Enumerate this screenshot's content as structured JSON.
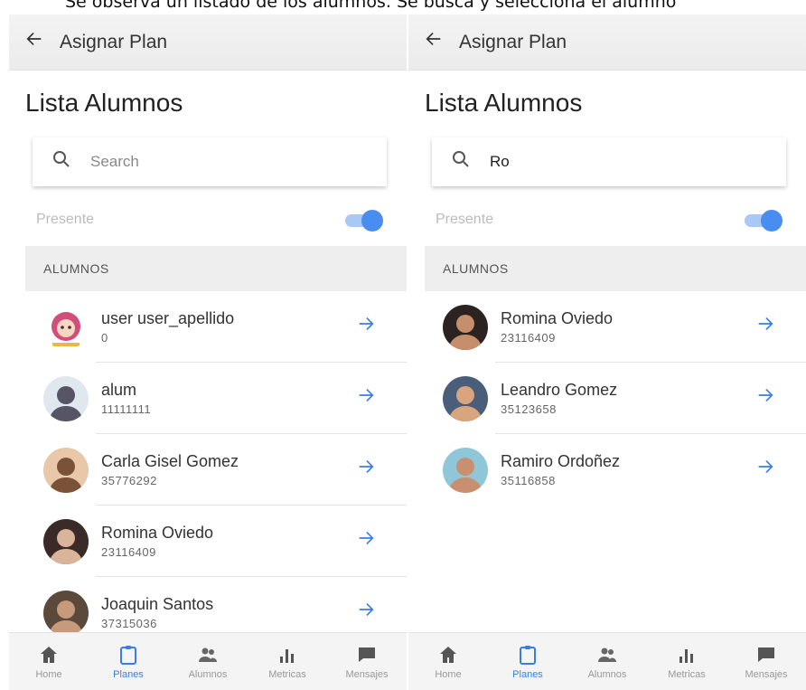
{
  "doc_caption": "Se observa un listado de los alumnos. Se busca y selecciona el alumno",
  "colors": {
    "accent": "#3a7de8",
    "toggle_on": "#4a8df0",
    "section_bg": "#eeeeee"
  },
  "screens": [
    {
      "appbar": {
        "back_icon": "arrow-left-icon",
        "title": "Asignar Plan"
      },
      "page_title": "Lista Alumnos",
      "search": {
        "placeholder": "Search",
        "value": ""
      },
      "presente": {
        "label": "Presente",
        "toggle_on": true
      },
      "section_header": "ALUMNOS",
      "students": [
        {
          "name": "user user_apellido",
          "id": "0",
          "avatar": "cartoon"
        },
        {
          "name": "alum",
          "id": "11111111",
          "avatar": "person"
        },
        {
          "name": "Carla Gisel Gomez",
          "id": "35776292",
          "avatar": "person"
        },
        {
          "name": "Romina Oviedo",
          "id": "23116409",
          "avatar": "person"
        },
        {
          "name": "Joaquin Santos",
          "id": "37315036",
          "avatar": "person"
        }
      ],
      "nav": [
        {
          "label": "Home",
          "icon": "home-icon",
          "active": false
        },
        {
          "label": "Planes",
          "icon": "clipboard-icon",
          "active": true
        },
        {
          "label": "Alumnos",
          "icon": "people-icon",
          "active": false
        },
        {
          "label": "Metricas",
          "icon": "bar-chart-icon",
          "active": false
        },
        {
          "label": "Mensajes",
          "icon": "message-icon",
          "active": false
        }
      ]
    },
    {
      "appbar": {
        "back_icon": "arrow-left-icon",
        "title": "Asignar Plan"
      },
      "page_title": "Lista Alumnos",
      "search": {
        "placeholder": "Search",
        "value": "Ro"
      },
      "presente": {
        "label": "Presente",
        "toggle_on": true
      },
      "section_header": "ALUMNOS",
      "students": [
        {
          "name": "Romina Oviedo",
          "id": "23116409",
          "avatar": "person"
        },
        {
          "name": "Leandro Gomez",
          "id": "35123658",
          "avatar": "person"
        },
        {
          "name": "Ramiro Ordoñez",
          "id": "35116858",
          "avatar": "person"
        }
      ],
      "nav": [
        {
          "label": "Home",
          "icon": "home-icon",
          "active": false
        },
        {
          "label": "Planes",
          "icon": "clipboard-icon",
          "active": true
        },
        {
          "label": "Alumnos",
          "icon": "people-icon",
          "active": false
        },
        {
          "label": "Metricas",
          "icon": "bar-chart-icon",
          "active": false
        },
        {
          "label": "Mensajes",
          "icon": "message-icon",
          "active": false
        }
      ]
    }
  ]
}
